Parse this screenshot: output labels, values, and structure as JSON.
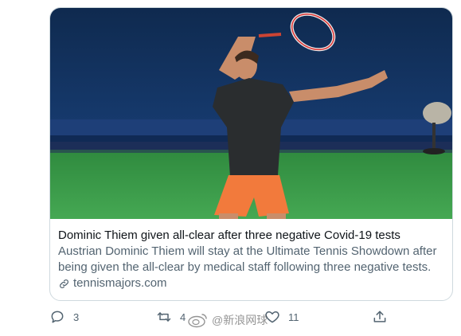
{
  "link_card": {
    "title": "Dominic Thiem given all-clear after three negative Covid-19 tests",
    "description": "Austrian Dominic Thiem will stay at the Ultimate Tennis Showdown after being given the all-clear by medical staff following three negative tests.",
    "domain": "tennismajors.com",
    "image_alt": "tennis player hitting a forehand on a hard court",
    "domain_icon": "link-icon"
  },
  "actions": {
    "reply": {
      "icon": "reply-icon",
      "count": "3"
    },
    "retweet": {
      "icon": "retweet-icon",
      "count": "4"
    },
    "like": {
      "icon": "heart-icon",
      "count": "11"
    },
    "share": {
      "icon": "share-icon"
    }
  },
  "watermark": {
    "text": "@新浪网球"
  },
  "colors": {
    "text_primary": "#0f1419",
    "text_secondary": "#536471",
    "border": "#cfd9de",
    "court_green": "#3a9a48",
    "wall_navy": "#12305a",
    "shorts_orange": "#f27a3c"
  }
}
